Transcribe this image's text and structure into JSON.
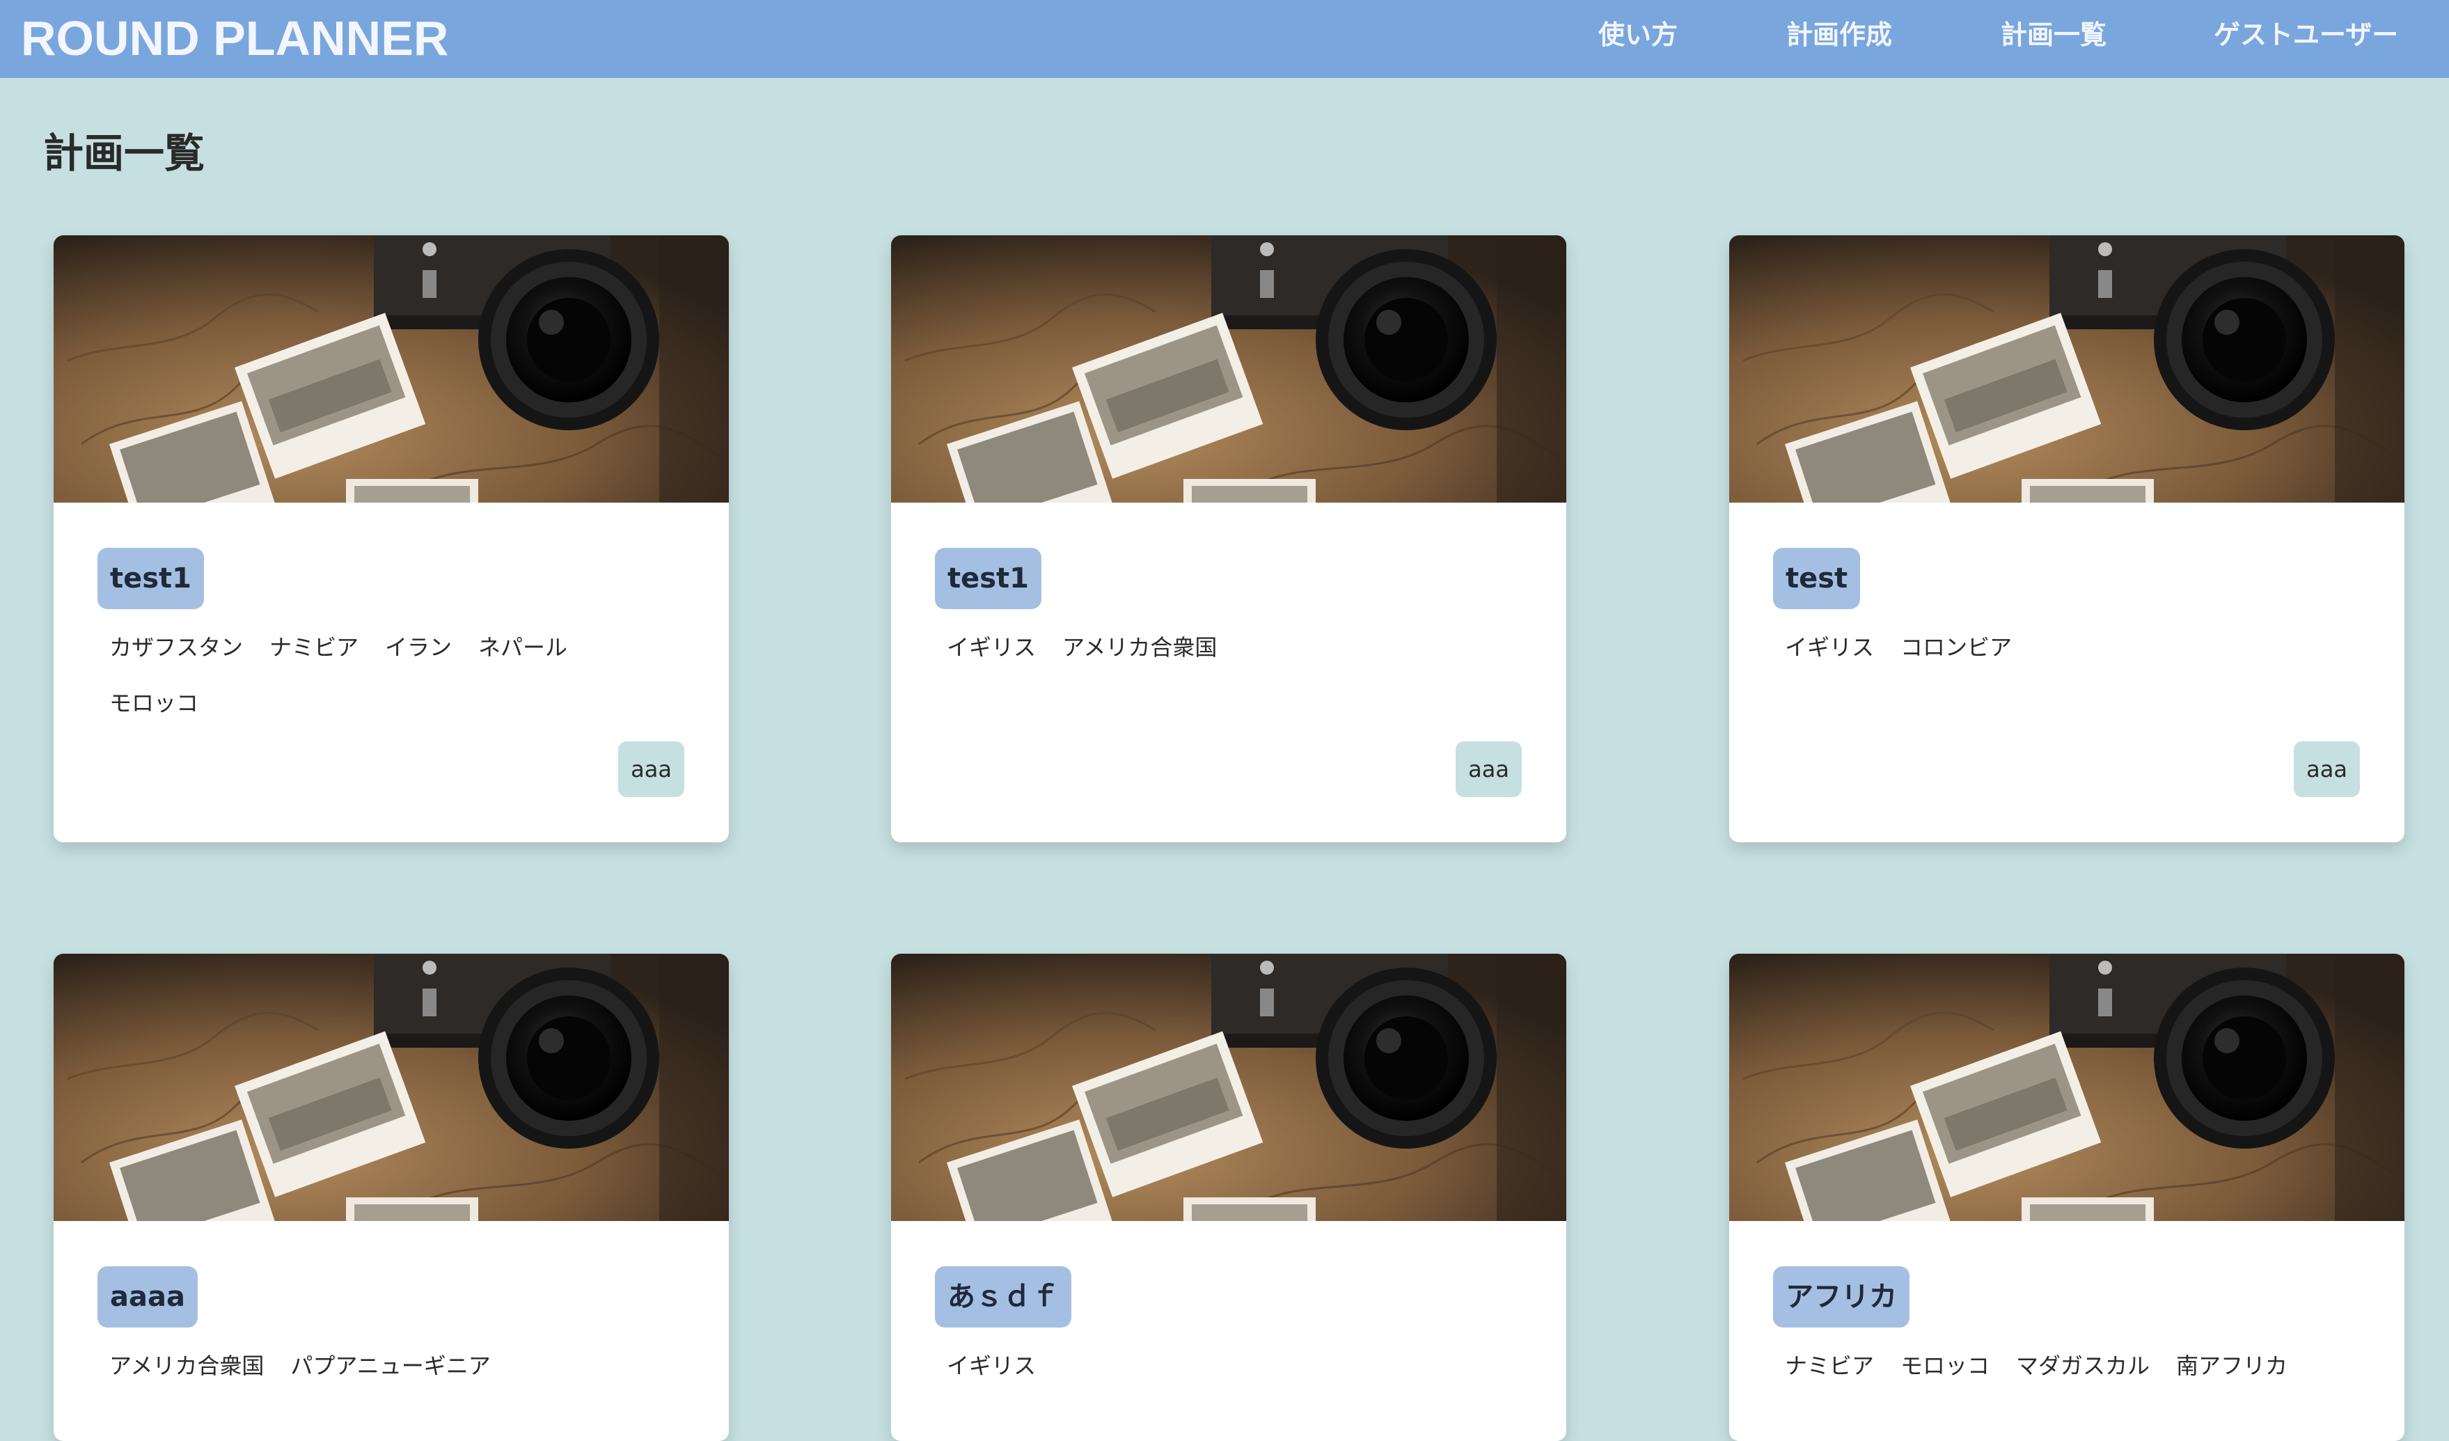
{
  "header": {
    "brand": "ROUND PLANNER",
    "nav": [
      "使い方",
      "計画作成",
      "計画一覧",
      "ゲストユーザー"
    ]
  },
  "page": {
    "title": "計画一覧"
  },
  "colors": {
    "navbar": "#79a6dc",
    "background": "#c6e0e1",
    "title_chip": "#a5bfe3",
    "tag_chip": "#c6e0e1"
  },
  "cards": [
    {
      "title": "test1",
      "countries": [
        "カザフスタン",
        "ナミビア",
        "イラン",
        "ネパール",
        "モロッコ"
      ],
      "tag": "aaa",
      "image_icon": "camera-map-photo"
    },
    {
      "title": "test1",
      "countries": [
        "イギリス",
        "アメリカ合衆国"
      ],
      "tag": "aaa",
      "image_icon": "camera-map-photo"
    },
    {
      "title": "test",
      "countries": [
        "イギリス",
        "コロンビア"
      ],
      "tag": "aaa",
      "image_icon": "camera-map-photo"
    },
    {
      "title": "aaaa",
      "countries": [
        "アメリカ合衆国",
        "パプアニューギニア"
      ],
      "tag": "",
      "image_icon": "camera-map-photo"
    },
    {
      "title": "あｓｄｆ",
      "countries": [
        "イギリス"
      ],
      "tag": "",
      "image_icon": "camera-map-photo"
    },
    {
      "title": "アフリカ",
      "countries": [
        "ナミビア",
        "モロッコ",
        "マダガスカル",
        "南アフリカ"
      ],
      "tag": "",
      "image_icon": "camera-map-photo"
    }
  ]
}
